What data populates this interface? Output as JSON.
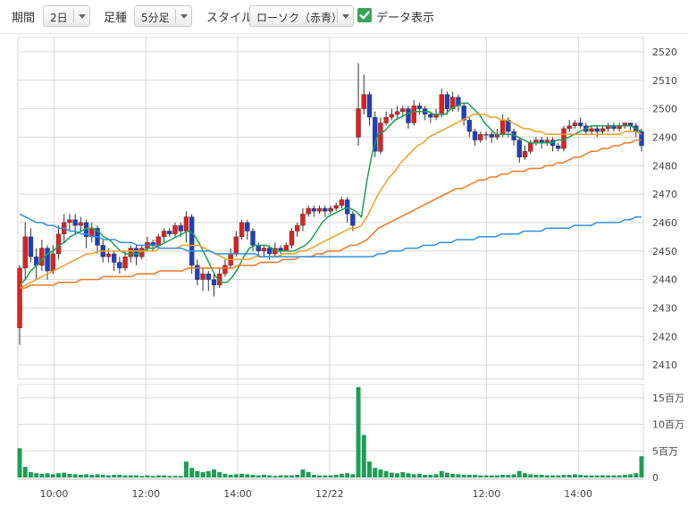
{
  "toolbar": {
    "period_label": "期間",
    "period_value": "2日",
    "interval_label": "足種",
    "interval_value": "5分足",
    "style_label": "スタイル",
    "style_value": "ローソク（赤青）",
    "show_data_label": "データ表示",
    "show_data_checked": true
  },
  "colors": {
    "up": "#e02020",
    "down": "#1f3fbf",
    "ma_short": "#1e9e55",
    "ma_mid": "#f0a020",
    "ma_long": "#f07820",
    "ma_vlong": "#3090e0",
    "volume": "#1e9e55",
    "grid": "#d8d8d8"
  },
  "chart_data": {
    "type": "candlestick",
    "x_tick_labels": [
      "10:00",
      "12:00",
      "14:00",
      "12/22",
      "12:00",
      "14:00"
    ],
    "y_tick_labels": [
      "2410",
      "2420",
      "2430",
      "2440",
      "2450",
      "2460",
      "2470",
      "2480",
      "2490",
      "2500",
      "2510",
      "2520"
    ],
    "ylim": [
      2405,
      2525
    ],
    "volume_tick_labels": [
      "15百万",
      "10百万",
      "5百万",
      "0"
    ],
    "volume_ylim": [
      0,
      17.5
    ],
    "volume_unit": "百万",
    "candles": [
      [
        2423,
        2444,
        2417,
        2445,
        5.5
      ],
      [
        2444,
        2455,
        2440,
        2460,
        2.0
      ],
      [
        2455,
        2448,
        2446,
        2458,
        1.0
      ],
      [
        2448,
        2445,
        2440,
        2451,
        0.8
      ],
      [
        2445,
        2451,
        2443,
        2454,
        0.7
      ],
      [
        2451,
        2443,
        2440,
        2452,
        0.8
      ],
      [
        2443,
        2449,
        2442,
        2452,
        0.6
      ],
      [
        2449,
        2456,
        2447,
        2459,
        0.8
      ],
      [
        2456,
        2460,
        2453,
        2463,
        0.9
      ],
      [
        2460,
        2461,
        2457,
        2463,
        0.7
      ],
      [
        2461,
        2459,
        2456,
        2463,
        0.6
      ],
      [
        2459,
        2460,
        2457,
        2462,
        0.5
      ],
      [
        2460,
        2455,
        2451,
        2461,
        0.6
      ],
      [
        2455,
        2458,
        2453,
        2460,
        0.5
      ],
      [
        2458,
        2452,
        2449,
        2459,
        0.6
      ],
      [
        2452,
        2448,
        2446,
        2454,
        0.5
      ],
      [
        2448,
        2449,
        2446,
        2451,
        0.4
      ],
      [
        2449,
        2446,
        2443,
        2450,
        0.5
      ],
      [
        2446,
        2444,
        2442,
        2448,
        0.5
      ],
      [
        2444,
        2448,
        2443,
        2450,
        0.4
      ],
      [
        2448,
        2451,
        2446,
        2452,
        0.4
      ],
      [
        2451,
        2448,
        2445,
        2452,
        0.4
      ],
      [
        2448,
        2451,
        2447,
        2452,
        0.3
      ],
      [
        2451,
        2453,
        2450,
        2455,
        0.4
      ],
      [
        2453,
        2452,
        2450,
        2454,
        0.3
      ],
      [
        2452,
        2455,
        2451,
        2456,
        0.4
      ],
      [
        2455,
        2457,
        2453,
        2458,
        0.4
      ],
      [
        2457,
        2456,
        2455,
        2458,
        0.3
      ],
      [
        2456,
        2459,
        2455,
        2460,
        0.3
      ],
      [
        2459,
        2457,
        2455,
        2460,
        0.3
      ],
      [
        2457,
        2462,
        2453,
        2464,
        3.0
      ],
      [
        2462,
        2445,
        2442,
        2463,
        1.8
      ],
      [
        2445,
        2440,
        2438,
        2447,
        1.2
      ],
      [
        2440,
        2442,
        2436,
        2444,
        1.0
      ],
      [
        2442,
        2440,
        2436,
        2443,
        1.2
      ],
      [
        2440,
        2438,
        2434,
        2442,
        1.5
      ],
      [
        2438,
        2442,
        2437,
        2444,
        1.0
      ],
      [
        2442,
        2445,
        2441,
        2447,
        0.7
      ],
      [
        2445,
        2449,
        2444,
        2451,
        0.5
      ],
      [
        2449,
        2455,
        2448,
        2457,
        0.6
      ],
      [
        2455,
        2460,
        2454,
        2461,
        0.7
      ],
      [
        2460,
        2457,
        2454,
        2461,
        0.6
      ],
      [
        2457,
        2452,
        2450,
        2458,
        0.5
      ],
      [
        2452,
        2450,
        2448,
        2453,
        0.4
      ],
      [
        2450,
        2451,
        2448,
        2452,
        0.5
      ],
      [
        2451,
        2449,
        2447,
        2452,
        0.4
      ],
      [
        2449,
        2451,
        2448,
        2453,
        0.3
      ],
      [
        2451,
        2450,
        2449,
        2452,
        0.4
      ],
      [
        2450,
        2452,
        2450,
        2453,
        0.4
      ],
      [
        2452,
        2457,
        2451,
        2458,
        0.4
      ],
      [
        2457,
        2459,
        2455,
        2460,
        0.5
      ],
      [
        2459,
        2463,
        2457,
        2465,
        1.5
      ],
      [
        2463,
        2465,
        2462,
        2466,
        1.0
      ],
      [
        2465,
        2464,
        2462,
        2466,
        0.5
      ],
      [
        2464,
        2465,
        2463,
        2466,
        0.4
      ],
      [
        2465,
        2464,
        2462,
        2466,
        0.4
      ],
      [
        2464,
        2465,
        2463,
        2466,
        0.4
      ],
      [
        2465,
        2466,
        2464,
        2467,
        0.5
      ],
      [
        2466,
        2468,
        2465,
        2469,
        0.7
      ],
      [
        2468,
        2463,
        2460,
        2469,
        0.8
      ],
      [
        2463,
        2459,
        2457,
        2464,
        0.6
      ],
      [
        2490,
        2500,
        2487,
        2516,
        17.0
      ],
      [
        2500,
        2505,
        2498,
        2512,
        8.0
      ],
      [
        2505,
        2497,
        2494,
        2506,
        3.0
      ],
      [
        2497,
        2485,
        2483,
        2499,
        1.8
      ],
      [
        2485,
        2495,
        2484,
        2497,
        1.5
      ],
      [
        2495,
        2497,
        2494,
        2499,
        1.2
      ],
      [
        2497,
        2498,
        2496,
        2500,
        0.9
      ],
      [
        2498,
        2499,
        2496,
        2501,
        0.8
      ],
      [
        2499,
        2500,
        2497,
        2501,
        1.0
      ],
      [
        2500,
        2495,
        2493,
        2501,
        0.8
      ],
      [
        2495,
        2501,
        2494,
        2503,
        0.6
      ],
      [
        2501,
        2500,
        2498,
        2502,
        0.7
      ],
      [
        2500,
        2498,
        2496,
        2501,
        0.5
      ],
      [
        2498,
        2497,
        2495,
        2499,
        0.5
      ],
      [
        2497,
        2498,
        2496,
        2500,
        0.6
      ],
      [
        2498,
        2505,
        2497,
        2507,
        1.2
      ],
      [
        2505,
        2500,
        2498,
        2506,
        0.9
      ],
      [
        2500,
        2504,
        2499,
        2506,
        0.7
      ],
      [
        2504,
        2501,
        2499,
        2505,
        0.6
      ],
      [
        2501,
        2496,
        2494,
        2502,
        0.5
      ],
      [
        2496,
        2492,
        2490,
        2497,
        0.5
      ],
      [
        2492,
        2489,
        2487,
        2493,
        0.5
      ],
      [
        2489,
        2491,
        2488,
        2492,
        0.4
      ],
      [
        2491,
        2491,
        2489,
        2492,
        0.4
      ],
      [
        2491,
        2490,
        2488,
        2492,
        0.4
      ],
      [
        2490,
        2491,
        2489,
        2493,
        0.4
      ],
      [
        2491,
        2496,
        2490,
        2498,
        0.5
      ],
      [
        2496,
        2492,
        2490,
        2497,
        0.5
      ],
      [
        2492,
        2489,
        2487,
        2493,
        0.6
      ],
      [
        2489,
        2483,
        2481,
        2490,
        1.2
      ],
      [
        2483,
        2485,
        2482,
        2487,
        0.8
      ],
      [
        2485,
        2488,
        2484,
        2489,
        0.6
      ],
      [
        2488,
        2489,
        2487,
        2490,
        0.5
      ],
      [
        2489,
        2488,
        2486,
        2490,
        0.5
      ],
      [
        2488,
        2489,
        2487,
        2490,
        0.4
      ],
      [
        2489,
        2487,
        2485,
        2490,
        0.4
      ],
      [
        2487,
        2486,
        2485,
        2488,
        0.4
      ],
      [
        2486,
        2493,
        2485,
        2494,
        0.5
      ],
      [
        2493,
        2494,
        2492,
        2496,
        0.5
      ],
      [
        2494,
        2495,
        2493,
        2496,
        0.6
      ],
      [
        2495,
        2494,
        2493,
        2497,
        0.5
      ],
      [
        2494,
        2492,
        2491,
        2495,
        0.4
      ],
      [
        2492,
        2493,
        2491,
        2494,
        0.4
      ],
      [
        2493,
        2492,
        2490,
        2494,
        0.4
      ],
      [
        2492,
        2493,
        2491,
        2494,
        0.4
      ],
      [
        2493,
        2494,
        2492,
        2495,
        0.4
      ],
      [
        2494,
        2493,
        2492,
        2495,
        0.4
      ],
      [
        2493,
        2494,
        2492,
        2495,
        0.4
      ],
      [
        2494,
        2495,
        2493,
        2495,
        0.5
      ],
      [
        2495,
        2494,
        2492,
        2495,
        0.6
      ],
      [
        2494,
        2492,
        2490,
        2495,
        0.8
      ],
      [
        2492,
        2487,
        2485,
        2493,
        4.0
      ]
    ],
    "ma_lines": [
      {
        "values": [
          2438,
          2440,
          2443,
          2445,
          2447,
          2449,
          2450,
          2452,
          2453,
          2455,
          2456,
          2457,
          2458,
          2458,
          2457,
          2455,
          2454,
          2452,
          2450,
          2449,
          2449,
          2449,
          2450,
          2451,
          2451,
          2452,
          2453,
          2454,
          2455,
          2456,
          2457,
          2456,
          2453,
          2449,
          2445,
          2441,
          2439,
          2439,
          2441,
          2444,
          2448,
          2451,
          2452,
          2452,
          2452,
          2451,
          2450,
          2450,
          2450,
          2450,
          2451,
          2452,
          2454,
          2457,
          2460,
          2462,
          2463,
          2464,
          2465,
          2465,
          2464,
          2462,
          2475,
          2485,
          2491,
          2492,
          2494,
          2496,
          2497,
          2498,
          2499,
          2499,
          2499,
          2499,
          2498,
          2498,
          2498,
          2500,
          2501,
          2502,
          2502,
          2500,
          2498,
          2495,
          2493,
          2491,
          2491,
          2491,
          2491,
          2490,
          2489,
          2488,
          2488,
          2488,
          2488,
          2488,
          2489,
          2489,
          2490,
          2491,
          2492,
          2493,
          2494,
          2494,
          2494,
          2494,
          2494,
          2494,
          2494,
          2494,
          2493,
          2492
        ]
      },
      {
        "values": [
          2437,
          2438,
          2439,
          2440,
          2441,
          2442,
          2443,
          2444,
          2445,
          2446,
          2447,
          2448,
          2449,
          2449,
          2450,
          2450,
          2450,
          2450,
          2450,
          2450,
          2450,
          2450,
          2450,
          2450,
          2450,
          2451,
          2451,
          2451,
          2451,
          2452,
          2452,
          2452,
          2452,
          2451,
          2450,
          2449,
          2448,
          2447,
          2447,
          2447,
          2447,
          2447,
          2448,
          2448,
          2448,
          2448,
          2448,
          2449,
          2449,
          2449,
          2450,
          2450,
          2451,
          2452,
          2453,
          2454,
          2455,
          2456,
          2457,
          2458,
          2458,
          2459,
          2462,
          2466,
          2470,
          2473,
          2476,
          2478,
          2481,
          2483,
          2485,
          2487,
          2488,
          2490,
          2491,
          2492,
          2493,
          2494,
          2495,
          2496,
          2497,
          2498,
          2498,
          2498,
          2497,
          2497,
          2496,
          2496,
          2495,
          2494,
          2493,
          2493,
          2492,
          2492,
          2491,
          2491,
          2491,
          2491,
          2491,
          2491,
          2491,
          2491,
          2491,
          2491,
          2491,
          2491,
          2491,
          2491,
          2492,
          2492,
          2492,
          2491
        ]
      },
      {
        "values": [
          2437,
          2437,
          2438,
          2438,
          2438,
          2438,
          2438,
          2439,
          2439,
          2439,
          2439,
          2440,
          2440,
          2440,
          2440,
          2441,
          2441,
          2441,
          2441,
          2441,
          2441,
          2442,
          2442,
          2442,
          2442,
          2443,
          2443,
          2443,
          2443,
          2443,
          2444,
          2444,
          2444,
          2444,
          2444,
          2444,
          2444,
          2444,
          2444,
          2445,
          2445,
          2445,
          2445,
          2446,
          2446,
          2446,
          2446,
          2447,
          2447,
          2447,
          2448,
          2448,
          2448,
          2449,
          2449,
          2450,
          2450,
          2450,
          2451,
          2452,
          2452,
          2453,
          2454,
          2456,
          2458,
          2459,
          2460,
          2461,
          2462,
          2463,
          2464,
          2465,
          2466,
          2467,
          2468,
          2469,
          2470,
          2471,
          2472,
          2472,
          2473,
          2474,
          2475,
          2475,
          2476,
          2476,
          2477,
          2477,
          2478,
          2478,
          2478,
          2479,
          2479,
          2479,
          2480,
          2480,
          2481,
          2481,
          2482,
          2483,
          2483,
          2484,
          2485,
          2485,
          2486,
          2486,
          2487,
          2487,
          2488,
          2488,
          2489,
          2489
        ]
      },
      {
        "values": [
          2463,
          2462,
          2461,
          2460,
          2460,
          2459,
          2459,
          2458,
          2458,
          2457,
          2457,
          2456,
          2456,
          2455,
          2455,
          2454,
          2454,
          2454,
          2453,
          2453,
          2453,
          2452,
          2452,
          2452,
          2452,
          2451,
          2451,
          2451,
          2451,
          2451,
          2450,
          2450,
          2450,
          2450,
          2450,
          2449,
          2449,
          2449,
          2449,
          2449,
          2449,
          2449,
          2449,
          2448,
          2448,
          2448,
          2448,
          2448,
          2448,
          2448,
          2448,
          2448,
          2448,
          2448,
          2448,
          2448,
          2448,
          2448,
          2448,
          2448,
          2448,
          2448,
          2448,
          2448,
          2449,
          2449,
          2450,
          2450,
          2450,
          2451,
          2451,
          2451,
          2452,
          2452,
          2452,
          2453,
          2453,
          2453,
          2454,
          2454,
          2454,
          2454,
          2455,
          2455,
          2455,
          2455,
          2456,
          2456,
          2456,
          2456,
          2457,
          2457,
          2457,
          2457,
          2458,
          2458,
          2458,
          2458,
          2458,
          2459,
          2459,
          2459,
          2459,
          2460,
          2460,
          2460,
          2460,
          2460,
          2461,
          2461,
          2462,
          2462
        ]
      }
    ],
    "grid": true
  }
}
